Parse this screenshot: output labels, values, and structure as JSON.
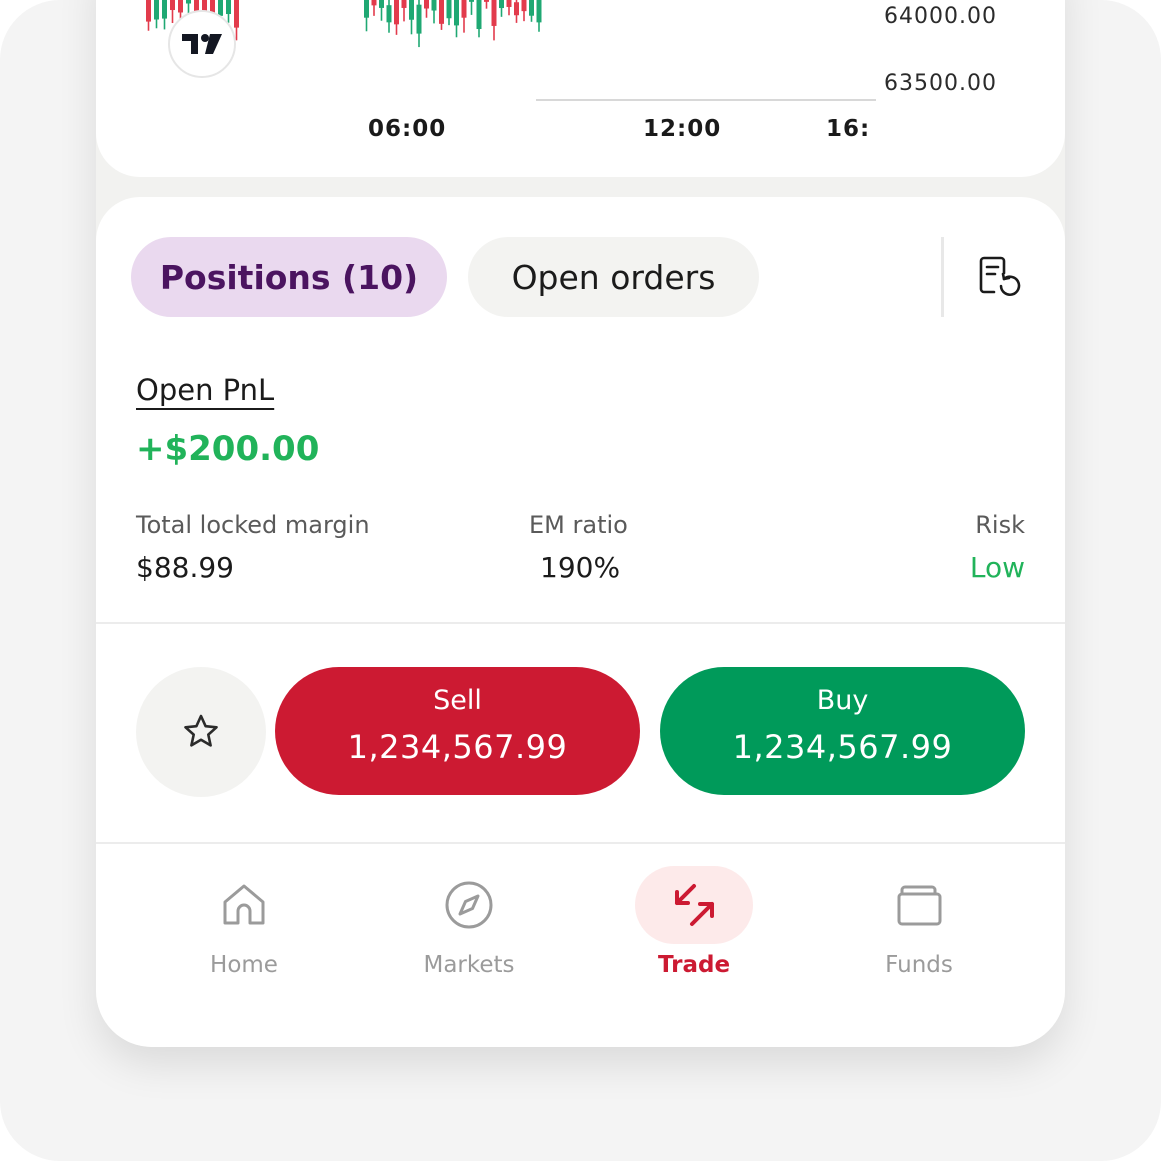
{
  "chart": {
    "price_labels": [
      "64000.00",
      "63500.00"
    ],
    "time_labels": [
      "06:00",
      "12:00",
      "16:"
    ],
    "logo_icon": "tradingview-logo-icon",
    "colors": {
      "up": "#1fa873",
      "down": "#e23b4c"
    }
  },
  "tabs": [
    {
      "label": "Positions (10)",
      "active": true
    },
    {
      "label": "Open orders",
      "active": false
    }
  ],
  "history_icon": "order-history-icon",
  "summary": {
    "pnl_label": "Open PnL",
    "pnl_value": "+$200.00",
    "locked_margin_label": "Total locked margin",
    "locked_margin_value": "$88.99",
    "em_ratio_label": "EM ratio",
    "em_ratio_value": "190%",
    "risk_label": "Risk",
    "risk_value": "Low"
  },
  "trade": {
    "favorite_icon": "star-icon",
    "sell_label": "Sell",
    "sell_price": "1,234,567.99",
    "buy_label": "Buy",
    "buy_price": "1,234,567.99",
    "colors": {
      "sell": "#cc1a32",
      "buy": "#009a5a"
    }
  },
  "nav": [
    {
      "label": "Home",
      "icon": "home-icon",
      "active": false
    },
    {
      "label": "Markets",
      "icon": "compass-icon",
      "active": false
    },
    {
      "label": "Trade",
      "icon": "trade-arrows-icon",
      "active": true
    },
    {
      "label": "Funds",
      "icon": "wallet-icon",
      "active": false
    }
  ]
}
